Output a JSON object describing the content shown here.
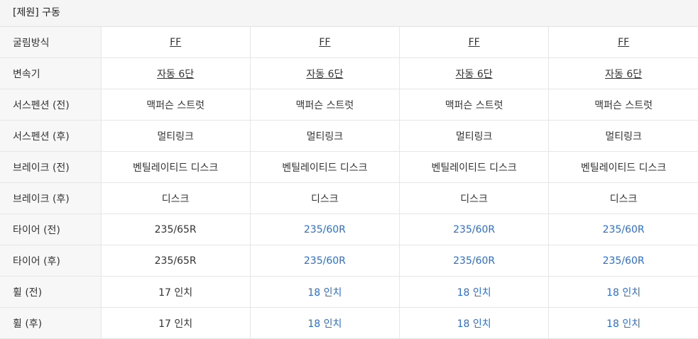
{
  "section": {
    "title": "[제원] 구동"
  },
  "colors": {
    "highlight": "#2b6fd6",
    "label_bg": "#f7f7f7",
    "header_bg": "#f5f5f5"
  },
  "rows": [
    {
      "label": "굴림방식",
      "values": [
        {
          "text": "FF",
          "style": "link"
        },
        {
          "text": "FF",
          "style": "link"
        },
        {
          "text": "FF",
          "style": "link"
        },
        {
          "text": "FF",
          "style": "link"
        }
      ]
    },
    {
      "label": "변속기",
      "values": [
        {
          "text": "자동 6단",
          "style": "link"
        },
        {
          "text": "자동 6단",
          "style": "link"
        },
        {
          "text": "자동 6단",
          "style": "link"
        },
        {
          "text": "자동 6단",
          "style": "link"
        }
      ]
    },
    {
      "label": "서스펜션 (전)",
      "values": [
        {
          "text": "맥퍼슨 스트럿",
          "style": "plain"
        },
        {
          "text": "맥퍼슨 스트럿",
          "style": "plain"
        },
        {
          "text": "맥퍼슨 스트럿",
          "style": "plain"
        },
        {
          "text": "맥퍼슨 스트럿",
          "style": "plain"
        }
      ]
    },
    {
      "label": "서스펜션 (후)",
      "values": [
        {
          "text": "멀티링크",
          "style": "plain"
        },
        {
          "text": "멀티링크",
          "style": "plain"
        },
        {
          "text": "멀티링크",
          "style": "plain"
        },
        {
          "text": "멀티링크",
          "style": "plain"
        }
      ]
    },
    {
      "label": "브레이크 (전)",
      "values": [
        {
          "text": "벤틸레이티드 디스크",
          "style": "plain"
        },
        {
          "text": "벤틸레이티드 디스크",
          "style": "plain"
        },
        {
          "text": "벤틸레이티드 디스크",
          "style": "plain"
        },
        {
          "text": "벤틸레이티드 디스크",
          "style": "plain"
        }
      ]
    },
    {
      "label": "브레이크 (후)",
      "values": [
        {
          "text": "디스크",
          "style": "plain"
        },
        {
          "text": "디스크",
          "style": "plain"
        },
        {
          "text": "디스크",
          "style": "plain"
        },
        {
          "text": "디스크",
          "style": "plain"
        }
      ]
    },
    {
      "label": "타이어 (전)",
      "values": [
        {
          "text": "235/65R",
          "style": "plain"
        },
        {
          "text": "235/60R",
          "style": "blue"
        },
        {
          "text": "235/60R",
          "style": "blue"
        },
        {
          "text": "235/60R",
          "style": "blue"
        }
      ]
    },
    {
      "label": "타이어 (후)",
      "values": [
        {
          "text": "235/65R",
          "style": "plain"
        },
        {
          "text": "235/60R",
          "style": "blue"
        },
        {
          "text": "235/60R",
          "style": "blue"
        },
        {
          "text": "235/60R",
          "style": "blue"
        }
      ]
    },
    {
      "label": "휠 (전)",
      "values": [
        {
          "text": "17 인치",
          "style": "plain"
        },
        {
          "text": "18 인치",
          "style": "blue"
        },
        {
          "text": "18 인치",
          "style": "blue"
        },
        {
          "text": "18 인치",
          "style": "blue"
        }
      ]
    },
    {
      "label": "휠 (후)",
      "values": [
        {
          "text": "17 인치",
          "style": "plain"
        },
        {
          "text": "18 인치",
          "style": "blue"
        },
        {
          "text": "18 인치",
          "style": "blue"
        },
        {
          "text": "18 인치",
          "style": "blue"
        }
      ]
    }
  ]
}
